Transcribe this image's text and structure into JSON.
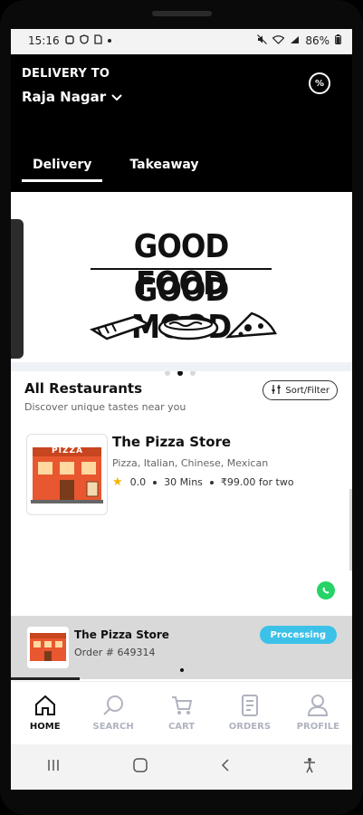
{
  "status_bar": {
    "time": "15:16",
    "battery": "86%"
  },
  "header": {
    "delivery_to": "DELIVERY TO",
    "location": "Raja Nagar",
    "offer_icon": "discount-icon"
  },
  "tabs": [
    {
      "label": "Delivery",
      "active": true
    },
    {
      "label": "Takeaway",
      "active": false
    }
  ],
  "banner": {
    "line1": "GOOD FOOD",
    "line2": "GOOD MOOD",
    "slides": 3,
    "active_slide": 2
  },
  "restaurants_section": {
    "title": "All Restaurants",
    "subtitle": "Discover unique tastes near you",
    "sort_label": "Sort/Filter"
  },
  "restaurants": [
    {
      "name": "The Pizza Store",
      "cuisines": "Pizza, Italian, Chinese, Mexican",
      "rating": "0.0",
      "time": "30 Mins",
      "price": "₹99.00 for two",
      "thumb_text": "PIZZA"
    }
  ],
  "active_order": {
    "name": "The Pizza Store",
    "order_number": "Order # 649314",
    "status": "Processing"
  },
  "bottom_nav": [
    {
      "label": "HOME",
      "icon": "home-icon",
      "active": true
    },
    {
      "label": "SEARCH",
      "icon": "search-icon",
      "active": false
    },
    {
      "label": "CART",
      "icon": "cart-icon",
      "active": false
    },
    {
      "label": "ORDERS",
      "icon": "orders-icon",
      "active": false
    },
    {
      "label": "PROFILE",
      "icon": "profile-icon",
      "active": false
    }
  ],
  "colors": {
    "header_bg": "#000000",
    "status_processing": "#3cc1e8",
    "nav_inactive": "#b0b3c0",
    "whatsapp": "#25d366"
  }
}
